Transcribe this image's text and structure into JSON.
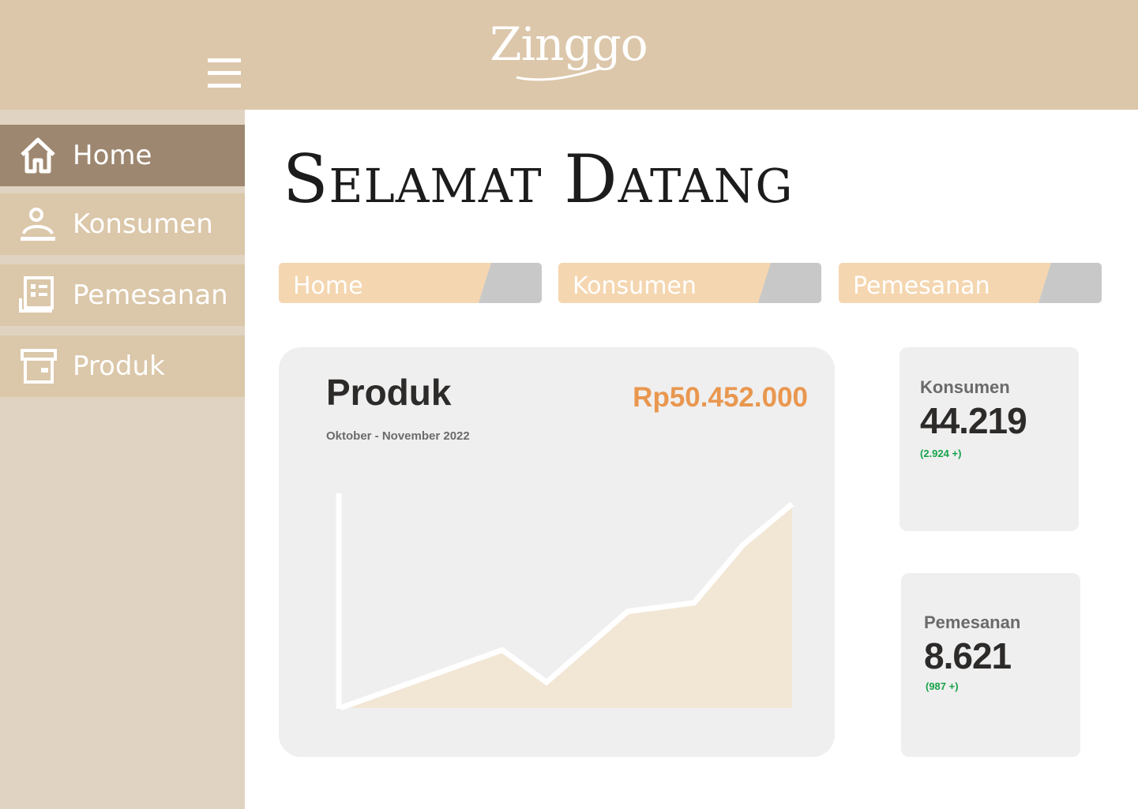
{
  "header": {
    "logo_text": "Zinggo",
    "menu_icon": "hamburger-menu-icon",
    "background_color": "#dcc7ab"
  },
  "sidebar": {
    "items": [
      {
        "label": "Home",
        "icon": "home-icon",
        "active": true
      },
      {
        "label": "Konsumen",
        "icon": "user-icon",
        "active": false
      },
      {
        "label": "Pemesanan",
        "icon": "order-list-icon",
        "active": false
      },
      {
        "label": "Produk",
        "icon": "box-icon",
        "active": false
      }
    ],
    "active_color": "#9e8770",
    "item_color": "#dbc7a9"
  },
  "main": {
    "title": "Selamat Datang",
    "tabs": [
      {
        "label": "Home"
      },
      {
        "label": "Konsumen"
      },
      {
        "label": "Pemesanan"
      }
    ],
    "product_card": {
      "title": "Produk",
      "period": "Oktober - November 2022",
      "value": "Rp50.452.000",
      "value_color": "#e9974f"
    },
    "konsumen_card": {
      "label": "Konsumen",
      "number": "44.219",
      "delta": "(2.924 +)"
    },
    "pemesanan_card": {
      "label": "Pemesanan",
      "number": "8.621",
      "delta": "(987 +)"
    }
  },
  "chart_data": {
    "type": "area",
    "x": [
      0,
      1,
      2,
      3,
      4,
      5,
      6
    ],
    "values": [
      0,
      0.27,
      0.12,
      0.45,
      0.49,
      0.76,
      0.95
    ],
    "grid": false,
    "line_color": "#ffffff",
    "fill_color": "#f2e6d5"
  }
}
